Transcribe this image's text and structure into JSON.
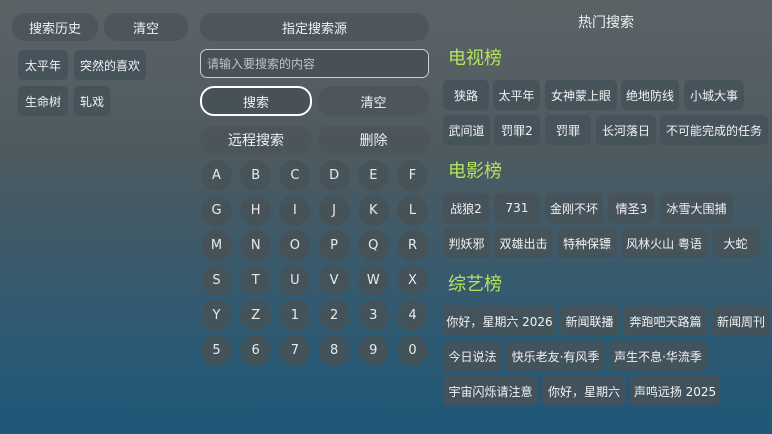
{
  "history": {
    "title": "搜索历史",
    "clear": "清空",
    "items": [
      "太平年",
      "突然的喜欢",
      "生命树",
      "轧戏"
    ]
  },
  "search": {
    "source_label": "指定搜索源",
    "placeholder": "请输入要搜索的内容",
    "search_btn": "搜索",
    "clear_btn": "清空",
    "remote_btn": "远程搜索",
    "delete_btn": "删除"
  },
  "keyboard": {
    "rows": [
      [
        "A",
        "B",
        "C",
        "D",
        "E",
        "F"
      ],
      [
        "G",
        "H",
        "I",
        "J",
        "K",
        "L"
      ],
      [
        "M",
        "N",
        "O",
        "P",
        "Q",
        "R"
      ],
      [
        "S",
        "T",
        "U",
        "V",
        "W",
        "X"
      ],
      [
        "Y",
        "Z",
        "1",
        "2",
        "3",
        "4"
      ],
      [
        "5",
        "6",
        "7",
        "8",
        "9",
        "0"
      ]
    ]
  },
  "hot": {
    "title": "热门搜索",
    "tv": {
      "title": "电视榜",
      "row1": [
        "狭路",
        "太平年",
        "女神蒙上眼",
        "绝地防线",
        "小城大事"
      ],
      "row2": [
        "武间道",
        "罚罪2",
        "罚罪",
        "长河落日",
        "不可能完成的任务"
      ]
    },
    "movie": {
      "title": "电影榜",
      "row1": [
        "战狼2",
        "731",
        "金刚不坏",
        "情圣3",
        "冰雪大围捕"
      ],
      "row2": [
        "判妖邪",
        "双雄出击",
        "特种保镖",
        "风林火山 粤语",
        "大蛇"
      ]
    },
    "variety": {
      "title": "综艺榜",
      "row1": [
        "你好，星期六 2026",
        "新闻联播",
        "奔跑吧天路篇",
        "新闻周刊"
      ],
      "row2": [
        "今日说法",
        "快乐老友·有风季",
        "声生不息·华流季"
      ],
      "row3": [
        "宇宙闪烁请注意",
        "你好，星期六",
        "声鸣远扬 2025"
      ]
    }
  }
}
